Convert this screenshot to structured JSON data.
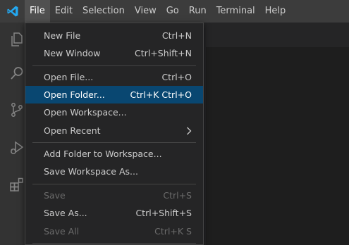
{
  "menubar": {
    "items": [
      "File",
      "Edit",
      "Selection",
      "View",
      "Go",
      "Run",
      "Terminal",
      "Help"
    ],
    "active": "File"
  },
  "activitybar": {
    "icons": [
      "explorer-icon",
      "search-icon",
      "source-control-icon",
      "run-debug-icon",
      "extensions-icon"
    ]
  },
  "file_menu": {
    "items": [
      {
        "label": "New File",
        "shortcut": "Ctrl+N"
      },
      {
        "label": "New Window",
        "shortcut": "Ctrl+Shift+N"
      },
      {
        "label": "Open File...",
        "shortcut": "Ctrl+O"
      },
      {
        "label": "Open Folder...",
        "shortcut": "Ctrl+K Ctrl+O",
        "highlighted": true
      },
      {
        "label": "Open Workspace...",
        "shortcut": ""
      },
      {
        "label": "Open Recent",
        "shortcut": "",
        "submenu": true
      },
      {
        "label": "Add Folder to Workspace...",
        "shortcut": ""
      },
      {
        "label": "Save Workspace As...",
        "shortcut": ""
      },
      {
        "label": "Save",
        "shortcut": "Ctrl+S",
        "disabled": true
      },
      {
        "label": "Save As...",
        "shortcut": "Ctrl+Shift+S"
      },
      {
        "label": "Save All",
        "shortcut": "Ctrl+K S",
        "disabled": true
      }
    ]
  },
  "colors": {
    "accent": "#007acc",
    "highlight": "#094771",
    "menubar_bg": "#3c3c3c",
    "menu_bg": "#252526"
  }
}
